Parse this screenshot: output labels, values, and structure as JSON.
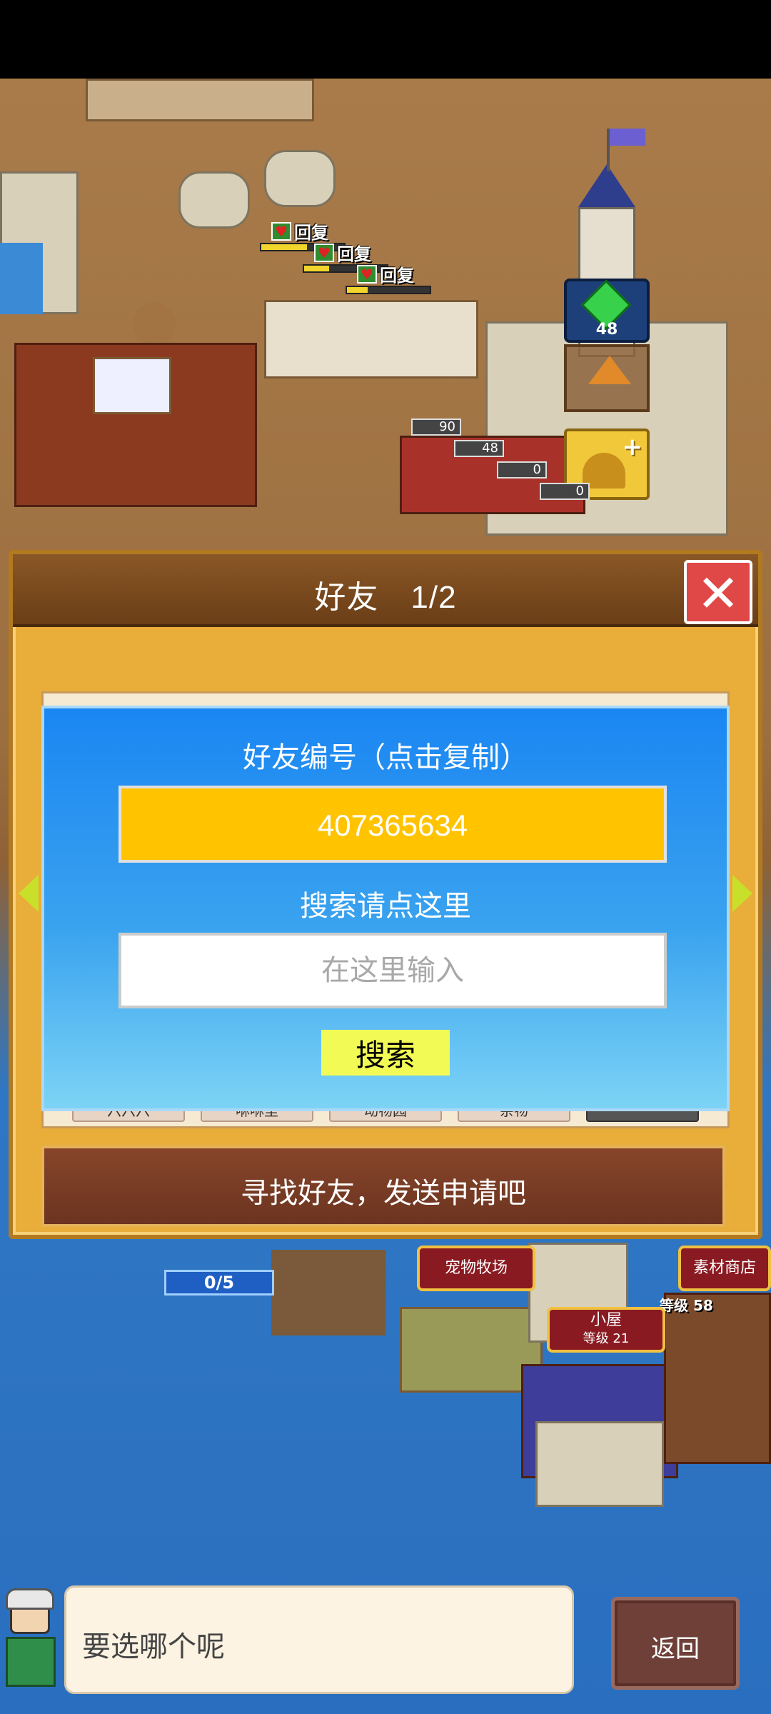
{
  "world": {
    "recover_labels": [
      "回复",
      "回复",
      "回复"
    ],
    "recover_fill": [
      0.55,
      0.3,
      0.25
    ],
    "gem_count": "48",
    "counters": [
      "90",
      "48",
      "0",
      "0"
    ],
    "signs": {
      "pet_ranch": "宠物牧场",
      "material_shop": "素材商店",
      "cabin": "小屋",
      "cabin_level": "等级 21",
      "shop_level": "等级 58"
    },
    "progress_badge": "0/5"
  },
  "dialog": {
    "title": "好友　1/2",
    "close_glyph": "✕",
    "peek_tabs": [
      "六六六",
      "咻咻里",
      "动物园",
      "杂物",
      ""
    ],
    "search_panel": {
      "friend_id_label": "好友编号（点击复制）",
      "friend_id_value": "407365634",
      "search_hint": "搜索请点这里",
      "input_placeholder": "在这里输入",
      "search_button": "搜索"
    },
    "find_friends_bar": "寻找好友，发送申请吧"
  },
  "bottom": {
    "speech_text": "要选哪个呢",
    "back_button": "返回"
  },
  "colors": {
    "dialog_bg": "#e9ad3a",
    "panel_blue": "#1a86f2",
    "id_box": "#ffc300",
    "search_button": "#f2fa56",
    "close_red": "#e04848"
  }
}
